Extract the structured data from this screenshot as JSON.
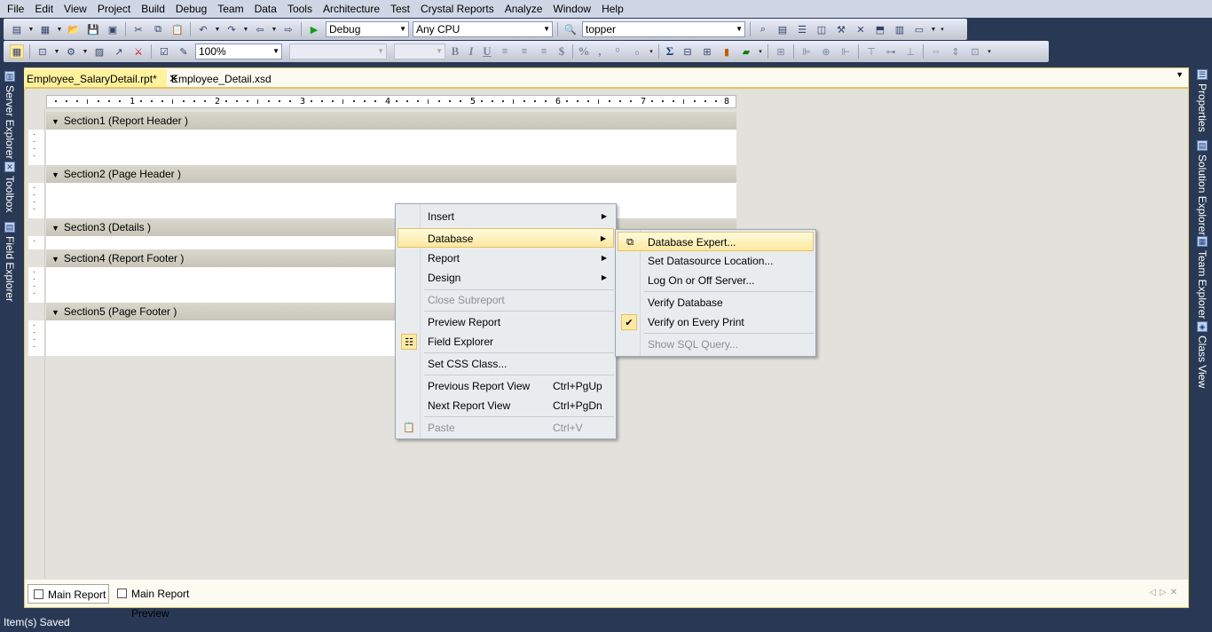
{
  "menubar": {
    "items": [
      "File",
      "Edit",
      "View",
      "Project",
      "Build",
      "Debug",
      "Team",
      "Data",
      "Tools",
      "Architecture",
      "Test",
      "Crystal Reports",
      "Analyze",
      "Window",
      "Help"
    ]
  },
  "toolbar1": {
    "config_value": "Debug",
    "platform_value": "Any CPU",
    "find_value": "topper"
  },
  "toolbar2": {
    "zoom_value": "100%",
    "font_value": "",
    "size_value": "",
    "bold": "B",
    "italic": "I",
    "underline": "U",
    "currency": "$",
    "percent": "%",
    "thousands": ",",
    "sum": "Σ"
  },
  "left_tool_windows": [
    "Server Explorer",
    "Toolbox",
    "Field Explorer"
  ],
  "right_tool_windows": [
    "Properties",
    "Solution Explorer",
    "Team Explorer",
    "Class View"
  ],
  "document_tabs": {
    "active": "Employee_SalaryDetail.rpt*",
    "inactive": "Employee_Detail.xsd"
  },
  "ruler": {
    "numbers": [
      "1",
      "2",
      "3",
      "4",
      "5",
      "6",
      "7",
      "8"
    ]
  },
  "sections": [
    {
      "label": "Section1 (Report Header  )"
    },
    {
      "label": "Section2 (Page Header  )"
    },
    {
      "label": "Section3 (Details  )"
    },
    {
      "label": "Section4 (Report Footer  )"
    },
    {
      "label": "Section5 (Page Footer  )"
    }
  ],
  "context_menu": {
    "insert": "Insert",
    "database": "Database",
    "report": "Report",
    "design": "Design",
    "close_subreport": "Close Subreport",
    "preview_report": "Preview Report",
    "field_explorer": "Field Explorer",
    "set_css_class": "Set CSS Class...",
    "previous_report_view": "Previous Report View",
    "previous_shortcut": "Ctrl+PgUp",
    "next_report_view": "Next Report View",
    "next_shortcut": "Ctrl+PgDn",
    "paste": "Paste",
    "paste_shortcut": "Ctrl+V"
  },
  "database_submenu": {
    "database_expert": "Database Expert...",
    "set_datasource_location": "Set Datasource Location...",
    "log_on_off_server": "Log On or Off Server...",
    "verify_database": "Verify Database",
    "verify_on_every_print": "Verify on Every Print",
    "verify_on_every_print_checked": true,
    "show_sql_query": "Show SQL Query..."
  },
  "bottom_tabs": {
    "main_report": "Main Report",
    "main_report_preview": "Main Report Preview"
  },
  "status": {
    "text": "Item(s) Saved"
  }
}
